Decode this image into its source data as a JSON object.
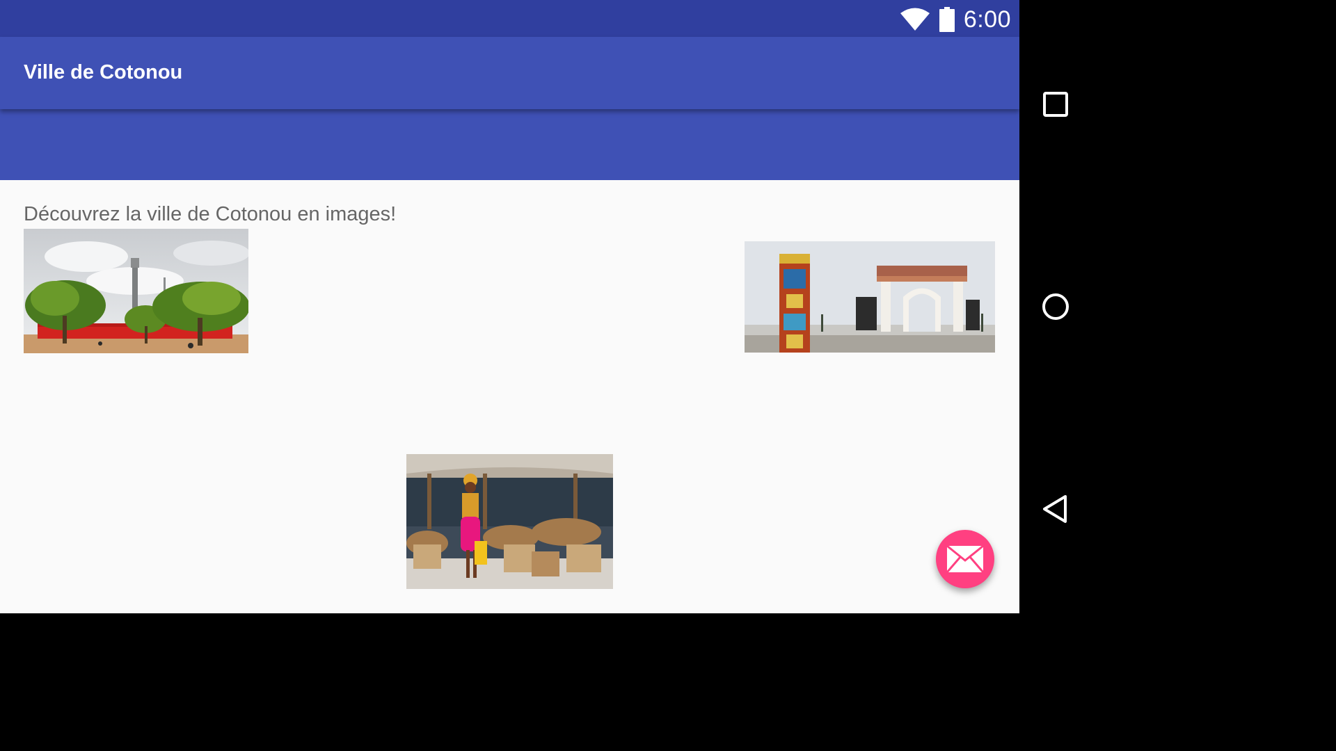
{
  "status_bar": {
    "time": "6:00",
    "icons": [
      "wifi-icon",
      "battery-icon"
    ]
  },
  "toolbar": {
    "title": "Ville de Cotonou"
  },
  "content": {
    "intro": "Découvrez la ville de Cotonou en images!"
  },
  "fab": {
    "icon": "mail-icon"
  },
  "nav_bar": {
    "buttons": [
      "recents-icon",
      "home-icon",
      "back-icon"
    ]
  },
  "colors": {
    "status_bar": "#303f9f",
    "primary": "#3f51b5",
    "accent": "#ff4081",
    "background": "#fafafa",
    "text_secondary": "#666666"
  }
}
